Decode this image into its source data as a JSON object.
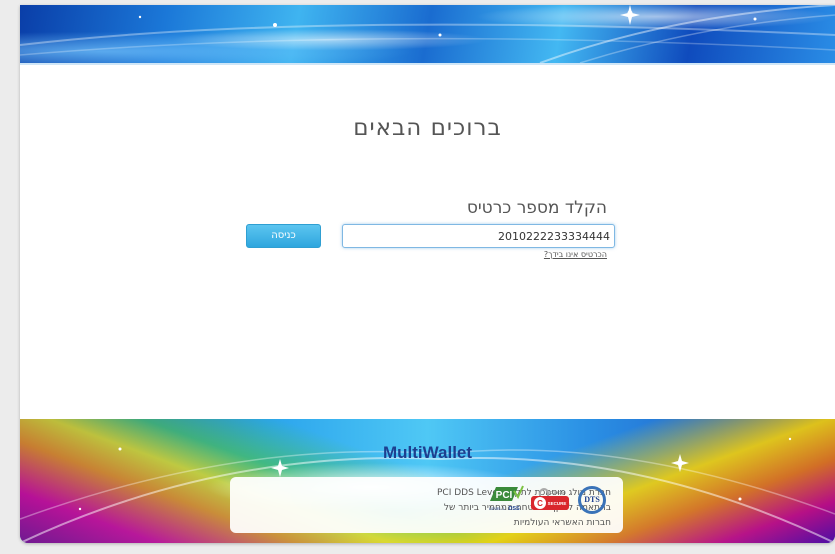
{
  "header": {
    "title": "ברוכים הבאים"
  },
  "login": {
    "label": "הקלד מספר כרטיס",
    "card_number": "2010222233334444",
    "enter_button": "כניסה",
    "invalid_card_link": "הכרטיס אינו בידך?"
  },
  "footer": {
    "brand": "MultiWallet",
    "certification_text": "חברת מולג מוסמכת לתקן PCI DDS Level 1 בהתאמה לתקן האבטחה המחמיר ביותר של חברות האשראי העולמיות",
    "logos": {
      "pci": {
        "main": "PCI",
        "sub": "DSS",
        "level": "LEVEL 1"
      },
      "secure": {
        "brand": "COMODO",
        "label": "SECURE"
      },
      "dts": {
        "label": "DTS"
      }
    }
  },
  "colors": {
    "button": "#2ea6de",
    "input_border": "#7fb8e3",
    "brand_text": "#1d3f8f",
    "background": "#ececec"
  }
}
